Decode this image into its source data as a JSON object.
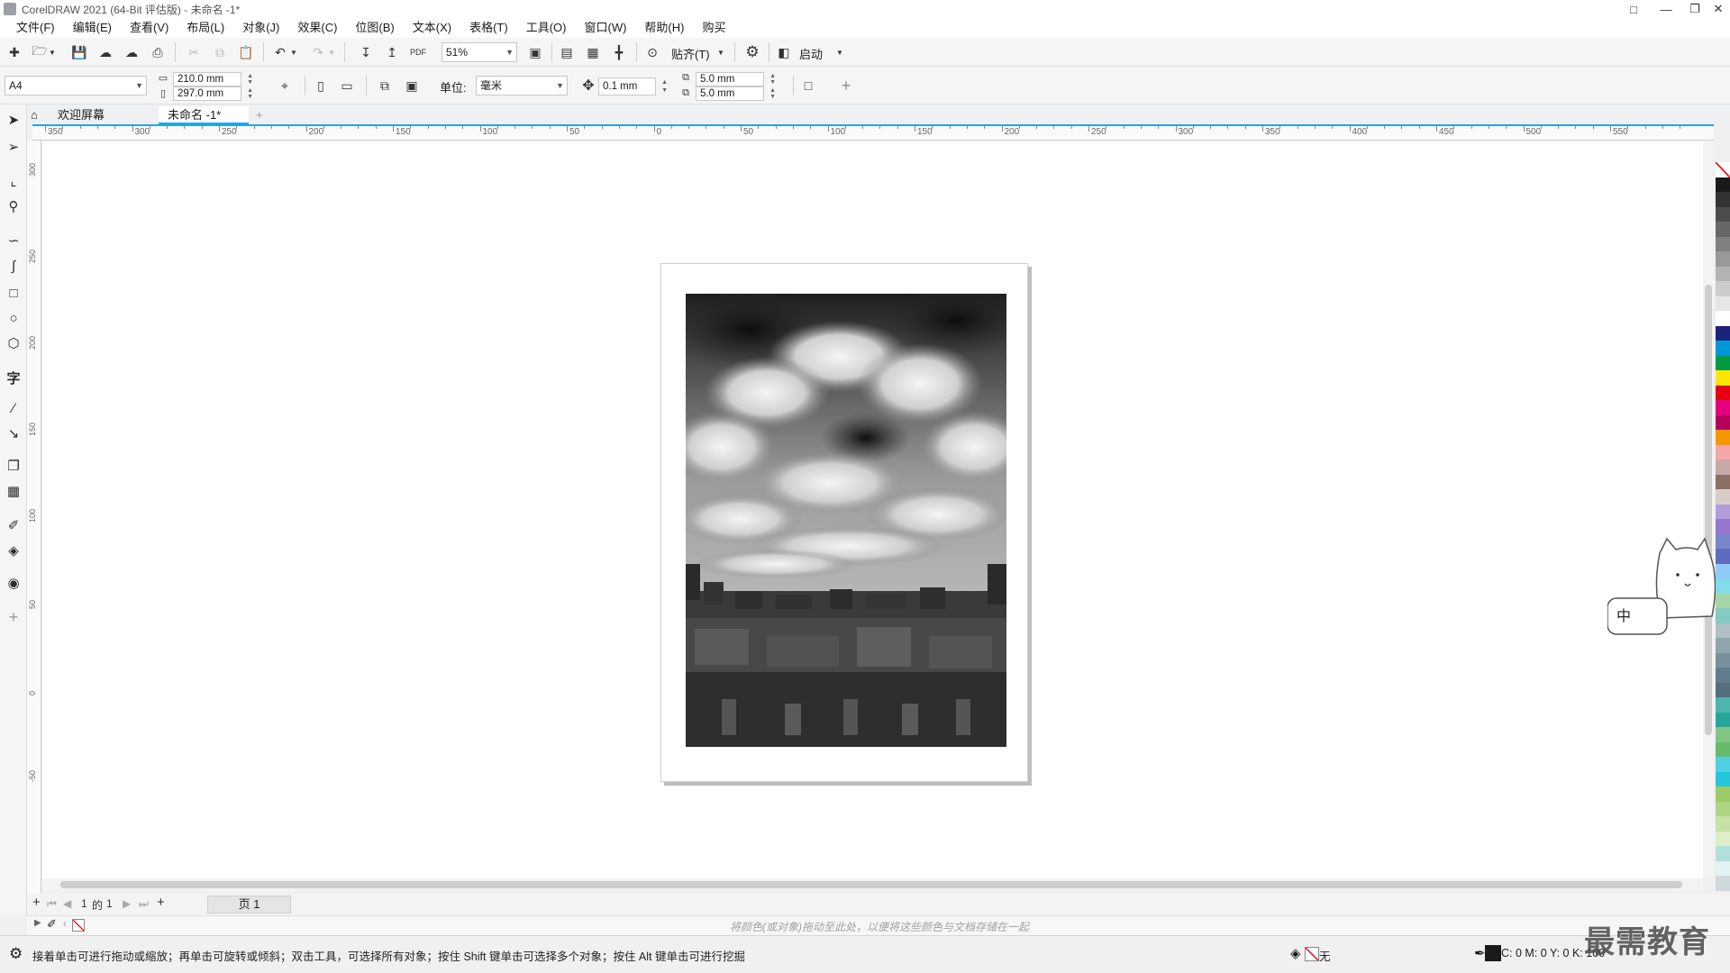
{
  "window": {
    "title": "CorelDRAW 2021 (64-Bit 评估版) - 未命名 -1*",
    "controls": [
      "restore-down",
      "minimize",
      "maximize",
      "close"
    ]
  },
  "menu": [
    "文件(F)",
    "编辑(E)",
    "查看(V)",
    "布局(L)",
    "对象(J)",
    "效果(C)",
    "位图(B)",
    "文本(X)",
    "表格(T)",
    "工具(O)",
    "窗口(W)",
    "帮助(H)",
    "购买"
  ],
  "toolbar": {
    "zoom": "51%",
    "snap_label": "贴齐(T)",
    "launch_label": "启动",
    "pdf_label": "PDF"
  },
  "property_bar": {
    "page_size": "A4",
    "width": "210.0 mm",
    "height": "297.0 mm",
    "unit_label": "单位:",
    "unit_value": "毫米",
    "nudge": "0.1 mm",
    "dup_x": "5.0 mm",
    "dup_y": "5.0 mm"
  },
  "tabs": [
    {
      "label": "欢迎屏幕",
      "active": false
    },
    {
      "label": "未命名 -1*",
      "active": true
    }
  ],
  "ruler": {
    "h_labels": [
      "350",
      "300",
      "250",
      "200",
      "150",
      "100",
      "50",
      "0",
      "50",
      "100",
      "150",
      "200",
      "250",
      "300",
      "350",
      "400",
      "450",
      "500",
      "550"
    ],
    "unit": "毫米"
  },
  "page_nav": {
    "current": "1",
    "of_label": "的",
    "total": "1",
    "page_tab": "页 1"
  },
  "color_docker_hint": "将颜色(或对象)拖动至此处，以便将这些颜色与文档存储在一起",
  "status": {
    "message": "接着单击可进行拖动或缩放；再单击可旋转或倾斜；双击工具，可选择所有对象；按住 Shift 键单击可选择多个对象；按住 Alt 键单击可进行挖掘",
    "fill_none": "无",
    "cmyk": "C: 0 M: 0 Y: 0 K: 100"
  },
  "watermark": "最需教育",
  "mascot_text": "中",
  "palette": [
    "#ffffff",
    "#1a1a1a",
    "#333333",
    "#4d4d4d",
    "#666666",
    "#808080",
    "#999999",
    "#b3b3b3",
    "#cccccc",
    "#e6e6e6",
    "#ffffff",
    "#1a237e",
    "#0097d7",
    "#009944",
    "#ffe600",
    "#e60012",
    "#e4007f",
    "#b5005b",
    "#f39800",
    "#f5a6a6",
    "#c9a9a6",
    "#8d6e63",
    "#d7ccc8",
    "#b39ddb",
    "#9575cd",
    "#7986cb",
    "#5c6bc0",
    "#90caf9",
    "#80deea",
    "#a5d6a7",
    "#80cbc4",
    "#b0bec5",
    "#90a4ae",
    "#78909c",
    "#607d8b",
    "#546e7a",
    "#4db6ac",
    "#26a69a",
    "#81c784",
    "#66bb6a",
    "#4dd0e1",
    "#26c6da",
    "#9ccc65",
    "#aed581",
    "#c5e1a5",
    "#dcedc8",
    "#b2dfdb",
    "#e0f2f1",
    "#cfd8dc"
  ]
}
